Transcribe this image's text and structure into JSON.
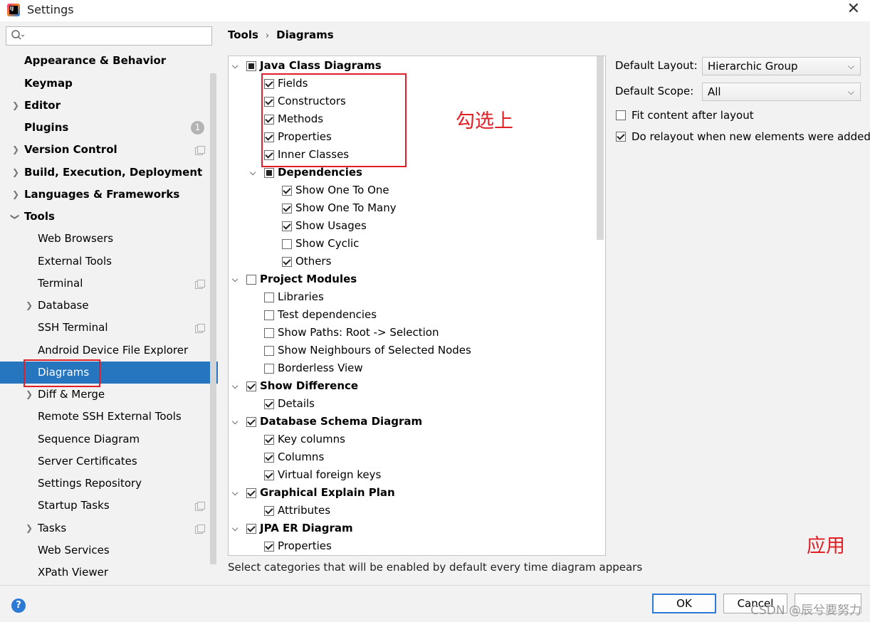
{
  "window": {
    "title": "Settings"
  },
  "search": {
    "placeholder": ""
  },
  "sidebar": {
    "items": [
      {
        "label": "Appearance & Behavior"
      },
      {
        "label": "Keymap"
      },
      {
        "label": "Editor"
      },
      {
        "label": "Plugins",
        "badge": "1"
      },
      {
        "label": "Version Control"
      },
      {
        "label": "Build, Execution, Deployment"
      },
      {
        "label": "Languages & Frameworks"
      },
      {
        "label": "Tools"
      },
      {
        "label": "Web Browsers"
      },
      {
        "label": "External Tools"
      },
      {
        "label": "Terminal"
      },
      {
        "label": "Database"
      },
      {
        "label": "SSH Terminal"
      },
      {
        "label": "Android Device File Explorer"
      },
      {
        "label": "Diagrams",
        "selected": true
      },
      {
        "label": "Diff & Merge"
      },
      {
        "label": "Remote SSH External Tools"
      },
      {
        "label": "Sequence Diagram"
      },
      {
        "label": "Server Certificates"
      },
      {
        "label": "Settings Repository"
      },
      {
        "label": "Startup Tasks"
      },
      {
        "label": "Tasks"
      },
      {
        "label": "Web Services"
      },
      {
        "label": "XPath Viewer"
      }
    ]
  },
  "breadcrumb": {
    "parent": "Tools",
    "current": "Diagrams",
    "separator": "›"
  },
  "tree": [
    {
      "label": "Java Class Diagrams",
      "state": "partial"
    },
    {
      "label": "Fields",
      "state": "checked"
    },
    {
      "label": "Constructors",
      "state": "checked"
    },
    {
      "label": "Methods",
      "state": "checked"
    },
    {
      "label": "Properties",
      "state": "checked"
    },
    {
      "label": "Inner Classes",
      "state": "checked"
    },
    {
      "label": "Dependencies",
      "state": "partial"
    },
    {
      "label": "Show One To One",
      "state": "checked"
    },
    {
      "label": "Show One To Many",
      "state": "checked"
    },
    {
      "label": "Show Usages",
      "state": "checked"
    },
    {
      "label": "Show Cyclic",
      "state": "unchecked"
    },
    {
      "label": "Others",
      "state": "checked"
    },
    {
      "label": "Project Modules",
      "state": "unchecked"
    },
    {
      "label": "Libraries",
      "state": "unchecked"
    },
    {
      "label": "Test dependencies",
      "state": "unchecked"
    },
    {
      "label": "Show Paths: Root -> Selection",
      "state": "unchecked"
    },
    {
      "label": "Show Neighbours of Selected Nodes",
      "state": "unchecked"
    },
    {
      "label": "Borderless View",
      "state": "unchecked"
    },
    {
      "label": "Show Difference",
      "state": "checked"
    },
    {
      "label": "Details",
      "state": "checked"
    },
    {
      "label": "Database Schema Diagram",
      "state": "checked"
    },
    {
      "label": "Key columns",
      "state": "checked"
    },
    {
      "label": "Columns",
      "state": "checked"
    },
    {
      "label": "Virtual foreign keys",
      "state": "checked"
    },
    {
      "label": "Graphical Explain Plan",
      "state": "checked"
    },
    {
      "label": "Attributes",
      "state": "checked"
    },
    {
      "label": "JPA ER Diagram",
      "state": "checked"
    },
    {
      "label": "Properties",
      "state": "checked"
    }
  ],
  "hint": "Select categories that will be enabled by default every time diagram appears",
  "options": {
    "layout_label": "Default Layout:",
    "layout_value": "Hierarchic Group",
    "scope_label": "Default Scope:",
    "scope_value": "All",
    "fit_label": "Fit content after layout",
    "fit_checked": false,
    "relayout_label": "Do relayout when new elements were added",
    "relayout_checked": true
  },
  "annotations": {
    "check_note": "勾选上",
    "apply_note": "应用"
  },
  "buttons": {
    "ok": "OK",
    "cancel": "Cancel",
    "help": "?"
  },
  "watermark": "CSDN @辰兮要努力",
  "colors": {
    "selection": "#2675bf",
    "annotation": "#e11f26",
    "primary_border": "#2a7ad6"
  }
}
